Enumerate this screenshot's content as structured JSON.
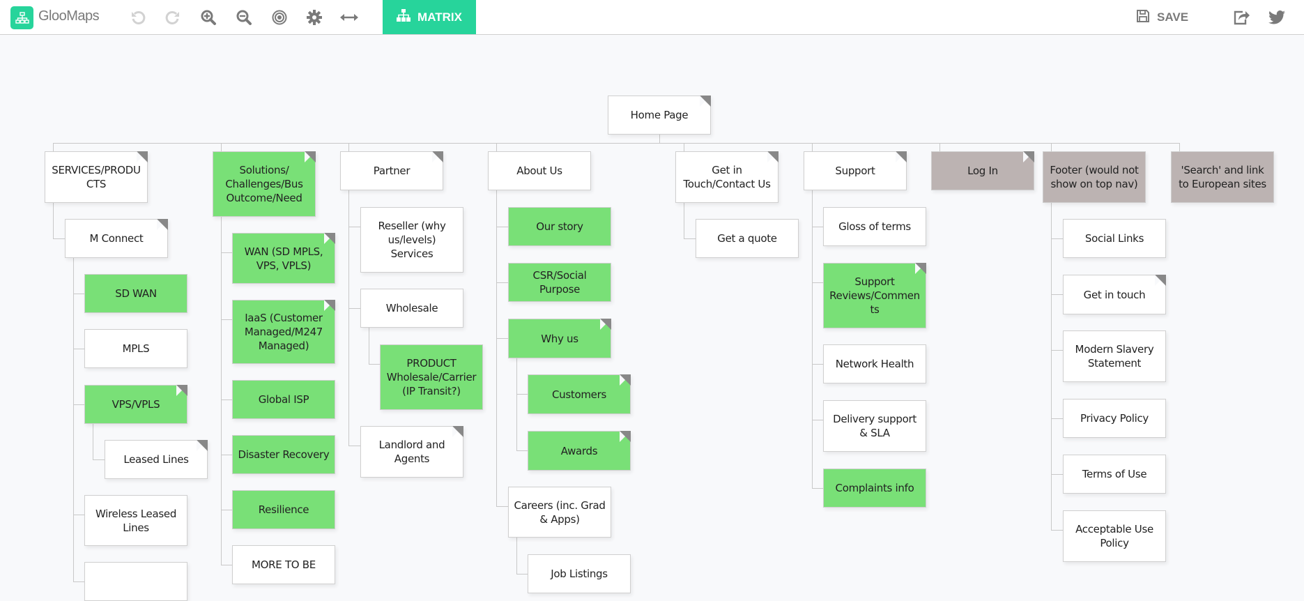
{
  "app": {
    "brand": "GlooMaps",
    "toolbar": {
      "undo": "undo-icon",
      "redo": "redo-icon",
      "zoom_in": "zoom-in-icon",
      "zoom_out": "zoom-out-icon",
      "center": "target-icon",
      "settings": "gear-icon",
      "width": "arrows-horizontal-icon",
      "matrix_label": "MATRIX",
      "save_label": "SAVE",
      "share": "share-icon",
      "twitter": "twitter-icon"
    },
    "colors": {
      "accent": "#27d49b",
      "node_green": "#79e077",
      "node_grey": "#bcb3b2",
      "node_white": "#ffffff",
      "fold": "#888888"
    }
  },
  "sitemap": {
    "root": {
      "id": "home",
      "label": "Home Page",
      "color": "white",
      "note": true
    },
    "nodes": [
      {
        "id": "services",
        "label": "SERVICES/PRODUCTS",
        "color": "white",
        "note": true,
        "parent": "home"
      },
      {
        "id": "mconnect",
        "label": "M Connect",
        "color": "white",
        "note": true,
        "parent": "services"
      },
      {
        "id": "sdwan",
        "label": "SD WAN",
        "color": "green",
        "note": false,
        "parent": "mconnect"
      },
      {
        "id": "mpls",
        "label": "MPLS",
        "color": "white",
        "note": false,
        "parent": "mconnect"
      },
      {
        "id": "vps",
        "label": "VPS/VPLS",
        "color": "green",
        "note": true,
        "parent": "mconnect"
      },
      {
        "id": "leased",
        "label": "Leased Lines",
        "color": "white",
        "note": true,
        "parent": "vps"
      },
      {
        "id": "wireless",
        "label": "Wireless Leased Lines",
        "color": "white",
        "note": false,
        "parent": "mconnect"
      },
      {
        "id": "svc_more",
        "label": "",
        "color": "white",
        "note": false,
        "parent": "mconnect"
      },
      {
        "id": "solutions",
        "label": "Solutions/ Challenges/Bus Outcome/Need",
        "color": "green",
        "note": true,
        "parent": "home"
      },
      {
        "id": "wan",
        "label": "WAN (SD MPLS, VPS, VPLS)",
        "color": "green",
        "note": true,
        "parent": "solutions"
      },
      {
        "id": "iaas",
        "label": "IaaS (Customer Managed/M247 Managed)",
        "color": "green",
        "note": true,
        "parent": "solutions"
      },
      {
        "id": "globalisp",
        "label": "Global ISP",
        "color": "green",
        "note": false,
        "parent": "solutions"
      },
      {
        "id": "dr",
        "label": "Disaster Recovery",
        "color": "green",
        "note": false,
        "parent": "solutions"
      },
      {
        "id": "resilience",
        "label": "Resilience",
        "color": "green",
        "note": false,
        "parent": "solutions"
      },
      {
        "id": "moretobe",
        "label": "MORE TO BE",
        "color": "white",
        "note": false,
        "parent": "solutions"
      },
      {
        "id": "partner",
        "label": "Partner",
        "color": "white",
        "note": true,
        "parent": "home"
      },
      {
        "id": "reseller",
        "label": "Reseller (why us/levels) Services",
        "color": "white",
        "note": false,
        "parent": "partner"
      },
      {
        "id": "wholesale",
        "label": "Wholesale",
        "color": "white",
        "note": false,
        "parent": "partner"
      },
      {
        "id": "product",
        "label": "PRODUCT Wholesale/Carrier (IP Transit?)",
        "color": "green",
        "note": false,
        "parent": "wholesale"
      },
      {
        "id": "landlord",
        "label": "Landlord and Agents",
        "color": "white",
        "note": true,
        "parent": "partner"
      },
      {
        "id": "about",
        "label": "About Us",
        "color": "white",
        "note": false,
        "parent": "home"
      },
      {
        "id": "story",
        "label": "Our story",
        "color": "green",
        "note": false,
        "parent": "about"
      },
      {
        "id": "csr",
        "label": "CSR/Social Purpose",
        "color": "green",
        "note": false,
        "parent": "about"
      },
      {
        "id": "whyus",
        "label": "Why us",
        "color": "green",
        "note": true,
        "parent": "about"
      },
      {
        "id": "customers",
        "label": "Customers",
        "color": "green",
        "note": true,
        "parent": "whyus"
      },
      {
        "id": "awards",
        "label": "Awards",
        "color": "green",
        "note": true,
        "parent": "whyus"
      },
      {
        "id": "careers",
        "label": "Careers (inc. Grad & Apps)",
        "color": "white",
        "note": false,
        "parent": "about"
      },
      {
        "id": "jobs",
        "label": "Job Listings",
        "color": "white",
        "note": false,
        "parent": "careers"
      },
      {
        "id": "contact",
        "label": "Get in Touch/Contact Us",
        "color": "white",
        "note": true,
        "parent": "home"
      },
      {
        "id": "quote",
        "label": "Get a quote",
        "color": "white",
        "note": false,
        "parent": "contact"
      },
      {
        "id": "support",
        "label": "Support",
        "color": "white",
        "note": true,
        "parent": "home"
      },
      {
        "id": "gloss",
        "label": "Gloss of terms",
        "color": "white",
        "note": false,
        "parent": "support"
      },
      {
        "id": "reviews",
        "label": "Support Reviews/Comments",
        "color": "green",
        "note": true,
        "parent": "support"
      },
      {
        "id": "network",
        "label": "Network Health",
        "color": "white",
        "note": false,
        "parent": "support"
      },
      {
        "id": "delivery",
        "label": "Delivery support & SLA",
        "color": "white",
        "note": false,
        "parent": "support"
      },
      {
        "id": "complaints",
        "label": "Complaints info",
        "color": "green",
        "note": false,
        "parent": "support"
      },
      {
        "id": "login",
        "label": "Log In",
        "color": "grey",
        "note": true,
        "parent": "home"
      },
      {
        "id": "footer",
        "label": "Footer (would not show on top nav)",
        "color": "grey",
        "note": false,
        "parent": "home"
      },
      {
        "id": "social",
        "label": "Social Links",
        "color": "white",
        "note": false,
        "parent": "footer"
      },
      {
        "id": "getintouch",
        "label": "Get in touch",
        "color": "white",
        "note": true,
        "parent": "footer"
      },
      {
        "id": "slavery",
        "label": "Modern Slavery Statement",
        "color": "white",
        "note": false,
        "parent": "footer"
      },
      {
        "id": "privacy",
        "label": "Privacy Policy",
        "color": "white",
        "note": false,
        "parent": "footer"
      },
      {
        "id": "terms",
        "label": "Terms of Use",
        "color": "white",
        "note": false,
        "parent": "footer"
      },
      {
        "id": "aup",
        "label": "Acceptable Use Policy",
        "color": "white",
        "note": false,
        "parent": "footer"
      },
      {
        "id": "search",
        "label": "'Search' and link to European sites",
        "color": "grey",
        "note": false,
        "parent": "home"
      }
    ]
  }
}
